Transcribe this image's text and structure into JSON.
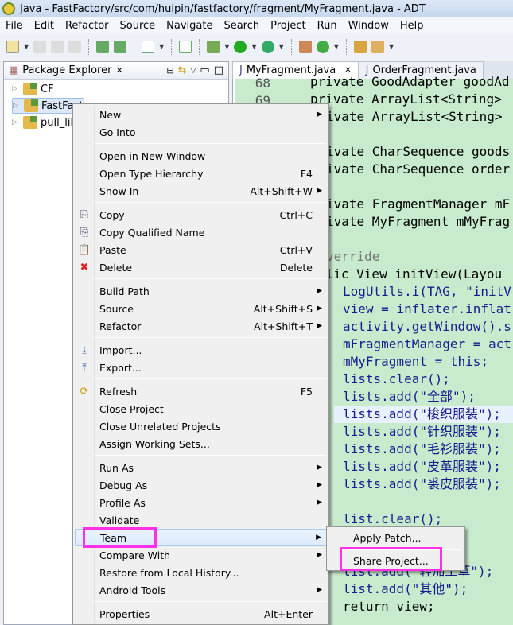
{
  "window": {
    "title": "Java - FastFactory/src/com/huipin/fastfactory/fragment/MyFragment.java - ADT"
  },
  "menubar": [
    "File",
    "Edit",
    "Refactor",
    "Source",
    "Navigate",
    "Search",
    "Project",
    "Run",
    "Window",
    "Help"
  ],
  "package_explorer": {
    "title": "Package Explorer",
    "projects": [
      "CF",
      "FastFact",
      "pull_lib"
    ]
  },
  "editor": {
    "tabs": [
      "MyFragment.java",
      "OrderFragment.java"
    ],
    "line_numbers": [
      "68",
      "69"
    ],
    "lines": [
      {
        "t": "private GoodAdapter goodAd",
        "indent": 1
      },
      {
        "t": "private ArrayList<String>",
        "indent": 1
      },
      {
        "t": "ivate ArrayList<String>",
        "indent": 1
      },
      {
        "t": "",
        "indent": 1
      },
      {
        "t": "ivate CharSequence goods",
        "indent": 1
      },
      {
        "t": "ivate CharSequence order",
        "indent": 1
      },
      {
        "t": "",
        "indent": 1
      },
      {
        "t": "ivate FragmentManager mF",
        "indent": 1
      },
      {
        "t": "ivate MyFragment mMyFrag",
        "indent": 1
      },
      {
        "t": "",
        "indent": 1
      },
      {
        "t": "verride",
        "indent": 1
      },
      {
        "t": "blic View initView(Layou",
        "indent": 0
      },
      {
        "t": "LogUtils.i(TAG, \"initV",
        "indent": 2
      },
      {
        "t": "view = inflater.inflat",
        "indent": 2
      },
      {
        "t": "activity.getWindow().s",
        "indent": 2
      },
      {
        "t": "mFragmentManager = act",
        "indent": 2
      },
      {
        "t": "mMyFragment = this;",
        "indent": 2
      },
      {
        "t": "lists.clear();",
        "indent": 2
      },
      {
        "t": "lists.add(\"全部\");",
        "indent": 2
      },
      {
        "t": "lists.add(\"梭织服装\");",
        "indent": 2
      },
      {
        "t": "lists.add(\"针织服装\");",
        "indent": 2
      },
      {
        "t": "lists.add(\"毛衫服装\");",
        "indent": 2
      },
      {
        "t": "lists.add(\"皮革服装\");",
        "indent": 2
      },
      {
        "t": "lists.add(\"裘皮服装\");",
        "indent": 2
      },
      {
        "t": "",
        "indent": 2
      },
      {
        "t": "list.clear();",
        "indent": 2
      },
      {
        "t": "list.add(\"…\");",
        "indent": 2
      },
      {
        "t": "list.add(\"…\"));",
        "indent": 2
      },
      {
        "t": "list.add(\"轻加工草\");",
        "indent": 2
      },
      {
        "t": "list.add(\"其他\");",
        "indent": 2
      },
      {
        "t": "return view;",
        "indent": 2
      }
    ]
  },
  "context_menu": {
    "items": [
      {
        "label": "New",
        "arrow": true
      },
      {
        "label": "Go Into"
      },
      {
        "sep": true
      },
      {
        "label": "Open in New Window"
      },
      {
        "label": "Open Type Hierarchy",
        "shortcut": "F4"
      },
      {
        "label": "Show In",
        "shortcut": "Alt+Shift+W",
        "arrow": true
      },
      {
        "sep": true
      },
      {
        "label": "Copy",
        "shortcut": "Ctrl+C",
        "icon": "copy-icon"
      },
      {
        "label": "Copy Qualified Name",
        "icon": "copy-qualified-icon"
      },
      {
        "label": "Paste",
        "shortcut": "Ctrl+V",
        "icon": "paste-icon"
      },
      {
        "label": "Delete",
        "shortcut": "Delete",
        "icon": "delete-icon"
      },
      {
        "sep": true
      },
      {
        "label": "Build Path",
        "arrow": true
      },
      {
        "label": "Source",
        "shortcut": "Alt+Shift+S",
        "arrow": true
      },
      {
        "label": "Refactor",
        "shortcut": "Alt+Shift+T",
        "arrow": true
      },
      {
        "sep": true
      },
      {
        "label": "Import...",
        "icon": "import-icon"
      },
      {
        "label": "Export...",
        "icon": "export-icon"
      },
      {
        "sep": true
      },
      {
        "label": "Refresh",
        "shortcut": "F5",
        "icon": "refresh-icon"
      },
      {
        "label": "Close Project"
      },
      {
        "label": "Close Unrelated Projects"
      },
      {
        "label": "Assign Working Sets..."
      },
      {
        "sep": true
      },
      {
        "label": "Run As",
        "arrow": true
      },
      {
        "label": "Debug As",
        "arrow": true
      },
      {
        "label": "Profile As",
        "arrow": true
      },
      {
        "label": "Validate"
      },
      {
        "label": "Team",
        "arrow": true,
        "highlighted": true
      },
      {
        "label": "Compare With",
        "arrow": true
      },
      {
        "label": "Restore from Local History..."
      },
      {
        "label": "Android Tools",
        "arrow": true
      },
      {
        "sep": true
      },
      {
        "label": "Properties",
        "shortcut": "Alt+Enter"
      }
    ]
  },
  "team_submenu": {
    "items": [
      "Apply Patch...",
      "Share Project..."
    ]
  },
  "colors": {
    "annotation": "#ff30e8",
    "editor_bg": "#c7ebcc",
    "keyword": "#7f0055",
    "field": "#2a00ff"
  }
}
